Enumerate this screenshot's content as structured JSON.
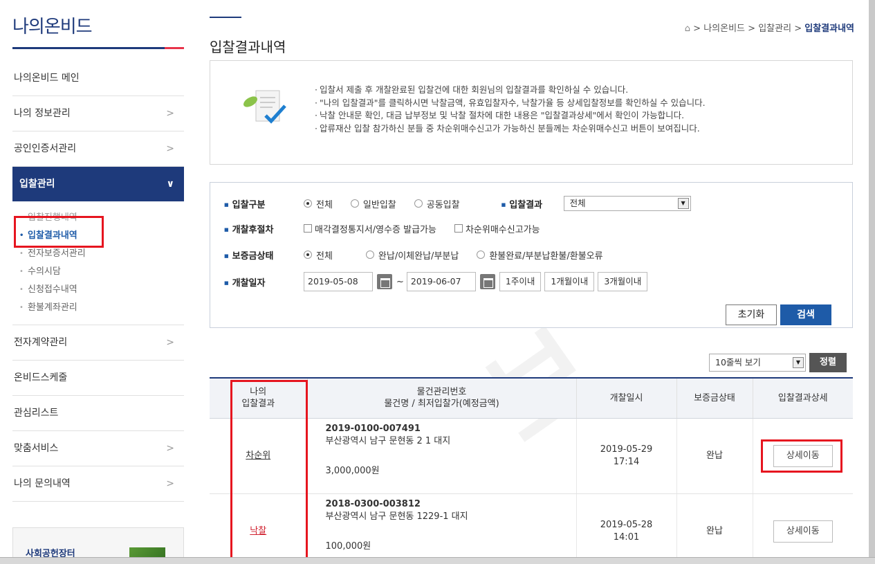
{
  "sidebar": {
    "title": "나의온비드",
    "items": [
      {
        "label": "나의온비드 메인",
        "chevron": false
      },
      {
        "label": "나의 정보관리",
        "chevron": true
      },
      {
        "label": "공인인증서관리",
        "chevron": true
      },
      {
        "label": "입찰관리",
        "active": true,
        "chevron_symbol": "∨"
      },
      {
        "label": "전자계약관리",
        "chevron": true
      },
      {
        "label": "온비드스케줄",
        "chevron": false
      },
      {
        "label": "관심리스트",
        "chevron": false
      },
      {
        "label": "맞춤서비스",
        "chevron": true
      },
      {
        "label": "나의 문의내역",
        "chevron": true
      }
    ],
    "chevron_symbol": ">",
    "subitems": [
      "입찰진행내역",
      "입찰결과내역",
      "전자보증서관리",
      "수의시담",
      "신청접수내역",
      "환불계좌관리"
    ],
    "banner_text": "사회공헌장터"
  },
  "page": {
    "title": "입찰결과내역",
    "breadcrumb": {
      "home_icon": "⌂",
      "sep": ">",
      "path1": "나의온비드",
      "path2": "입찰관리",
      "current": "입찰결과내역"
    }
  },
  "info": {
    "lines": [
      "입찰서 제출 후 개찰완료된 입찰건에 대한 회원님의 입찰결과를 확인하실 수 있습니다.",
      "\"나의 입찰결과\"를 클릭하시면 낙찰금액, 유효입찰자수, 낙찰가율 등 상세입찰정보를 확인하실 수 있습니다.",
      "낙찰 안내문 확인, 대금 납부정보 및 낙찰 절차에 대한 내용은 \"입찰결과상세\"에서 확인이 가능합니다.",
      "압류재산 입찰 참가하신 분들 중 차순위매수신고가 가능하신 분들께는 차순위매수신고 버튼이 보여집니다."
    ]
  },
  "search": {
    "bid_type_label": "입찰구분",
    "bid_type_options": [
      "전체",
      "일반입찰",
      "공동입찰"
    ],
    "bid_result_label": "입찰결과",
    "bid_result_value": "전체",
    "post_label": "개찰후절차",
    "post_options": [
      "매각결정통지서/영수증 발급가능",
      "차순위매수신고가능"
    ],
    "deposit_label": "보증금상태",
    "deposit_options": [
      "전체",
      "완납/이체완납/부분납",
      "환불완료/부분납환불/환불오류"
    ],
    "date_label": "개찰일자",
    "date_from": "2019-05-08",
    "date_sep": "~",
    "date_to": "2019-06-07",
    "periods": [
      "1주이내",
      "1개월이내",
      "3개월이내"
    ],
    "reset_label": "초기화",
    "search_label": "검색"
  },
  "list": {
    "rows_select": "10줄씩 보기",
    "sort_label": "정렬",
    "headers": {
      "result1": "나의",
      "result2": "입찰결과",
      "item1": "물건관리번호",
      "item2": "물건명 / 최저입찰가(예정금액)",
      "date": "개찰일시",
      "deposit": "보증금상태",
      "detail": "입찰결과상세"
    },
    "rows": [
      {
        "result": "차순위",
        "number": "2019-0100-007491",
        "address": "부산광역시 남구 문현동 2 1 대지",
        "price": "3,000,000원",
        "date": "2019-05-29",
        "time": "17:14",
        "deposit": "완납",
        "detail": "상세이동"
      },
      {
        "result": "낙찰",
        "number": "2018-0300-003812",
        "address": "부산광역시 남구 문현동 1229-1 대지",
        "price": "100,000원",
        "date": "2019-05-28",
        "time": "14:01",
        "deposit": "완납",
        "detail": "상세이동"
      }
    ]
  },
  "colors": {
    "brand": "#1e3a7b",
    "accent": "#1e5ba8",
    "highlight": "#e6151f",
    "win": "#d0202e"
  }
}
